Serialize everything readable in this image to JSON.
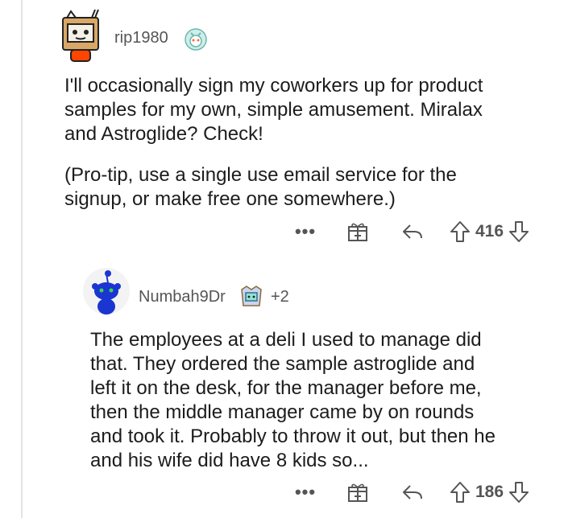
{
  "comment1": {
    "username": "rip1980",
    "paragraphs": [
      "I'll occasionally sign my coworkers up for product samples for my own, simple amusement.  Miralax and Astroglide?  Check!",
      "(Pro-tip, use a single use email service for the signup, or make free one somewhere.)"
    ],
    "lines_p1": [
      "I'll occasionally sign my coworkers up for product",
      "samples for my own, simple amusement.  Miralax",
      "and Astroglide?  Check!"
    ],
    "lines_p2": [
      "(Pro-tip, use a single use email service for the",
      "signup, or make free one somewhere.)"
    ],
    "more_label": "•••",
    "score": "416",
    "icons": [
      "more-icon",
      "gift-icon",
      "reply-icon",
      "upvote-icon",
      "downvote-icon"
    ]
  },
  "comment2": {
    "username": "Numbah9Dr",
    "flair_extra": "+2",
    "lines": [
      "The employees at a deli I used to manage did",
      "that. They ordered the sample astroglide and",
      "left it on the desk, for the manager before me,",
      "then the middle manager came by on rounds",
      "and took it. Probably to throw it out, but then he",
      "and his wife did have 8 kids so..."
    ],
    "more_label": "•••",
    "score": "186",
    "icons": [
      "more-icon",
      "gift-icon",
      "reply-icon",
      "upvote-icon",
      "downvote-icon"
    ]
  },
  "colors": {
    "text": "#1c1c1c",
    "meta": "#555555",
    "thread_line": "#e3e3e3",
    "snoo_blue": "#1b35d1"
  }
}
